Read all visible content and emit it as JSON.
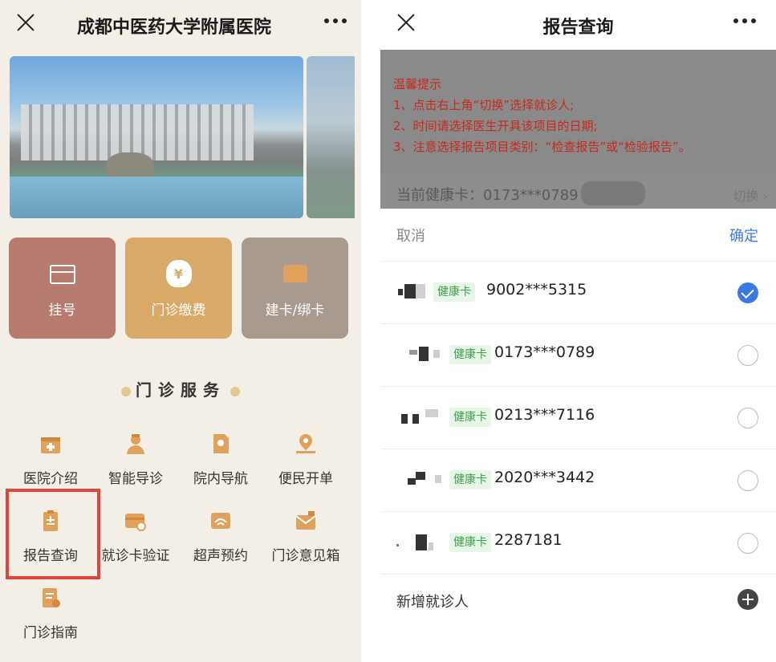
{
  "left": {
    "title": "成都中医药大学附属医院",
    "tiles": [
      {
        "label": "挂号",
        "icon": "card-icon"
      },
      {
        "label": "门诊缴费",
        "icon": "money-bag-icon",
        "glyph": "¥"
      },
      {
        "label": "建卡/绑卡",
        "icon": "wallet-icon"
      }
    ],
    "section_title": "门诊服务",
    "services": [
      {
        "label": "医院介绍",
        "icon": "hospital-icon"
      },
      {
        "label": "智能导诊",
        "icon": "doctor-icon"
      },
      {
        "label": "院内导航",
        "icon": "location-icon"
      },
      {
        "label": "便民开单",
        "icon": "order-icon"
      },
      {
        "label": "报告查询",
        "icon": "report-icon"
      },
      {
        "label": "就诊卡验证",
        "icon": "card-verify-icon"
      },
      {
        "label": "超声预约",
        "icon": "ultrasound-icon"
      },
      {
        "label": "门诊意见箱",
        "icon": "mailbox-icon"
      },
      {
        "label": "门诊指南",
        "icon": "guide-icon"
      }
    ],
    "accent_color": "#e0a25a",
    "highlight_color": "#e0443a"
  },
  "right": {
    "title": "报告查询",
    "notice": {
      "heading": "温馨提示",
      "lines": [
        "1、点击右上角“切换”选择就诊人;",
        "2、时间请选择医生开具该项目的日期;",
        "3、注意选择报告项目类别：“检查报告”或“检验报告”。"
      ]
    },
    "current_card_label": "当前健康卡：0173***0789",
    "switch_label": "切换",
    "cancel_label": "取消",
    "confirm_label": "确定",
    "patients": [
      {
        "badge": "健康卡",
        "card_no": "9002***5315",
        "selected": true
      },
      {
        "badge": "健康卡",
        "card_no": "0173***0789",
        "selected": false
      },
      {
        "badge": "健康卡",
        "card_no": "0213***7116",
        "selected": false
      },
      {
        "badge": "健康卡",
        "card_no": "2020***3442",
        "selected": false
      },
      {
        "badge": "健康卡",
        "card_no": "2287181",
        "selected": false
      }
    ],
    "add_patient_label": "新增就诊人",
    "accent_color": "#3a7ae0",
    "notice_color": "#c8281e"
  }
}
